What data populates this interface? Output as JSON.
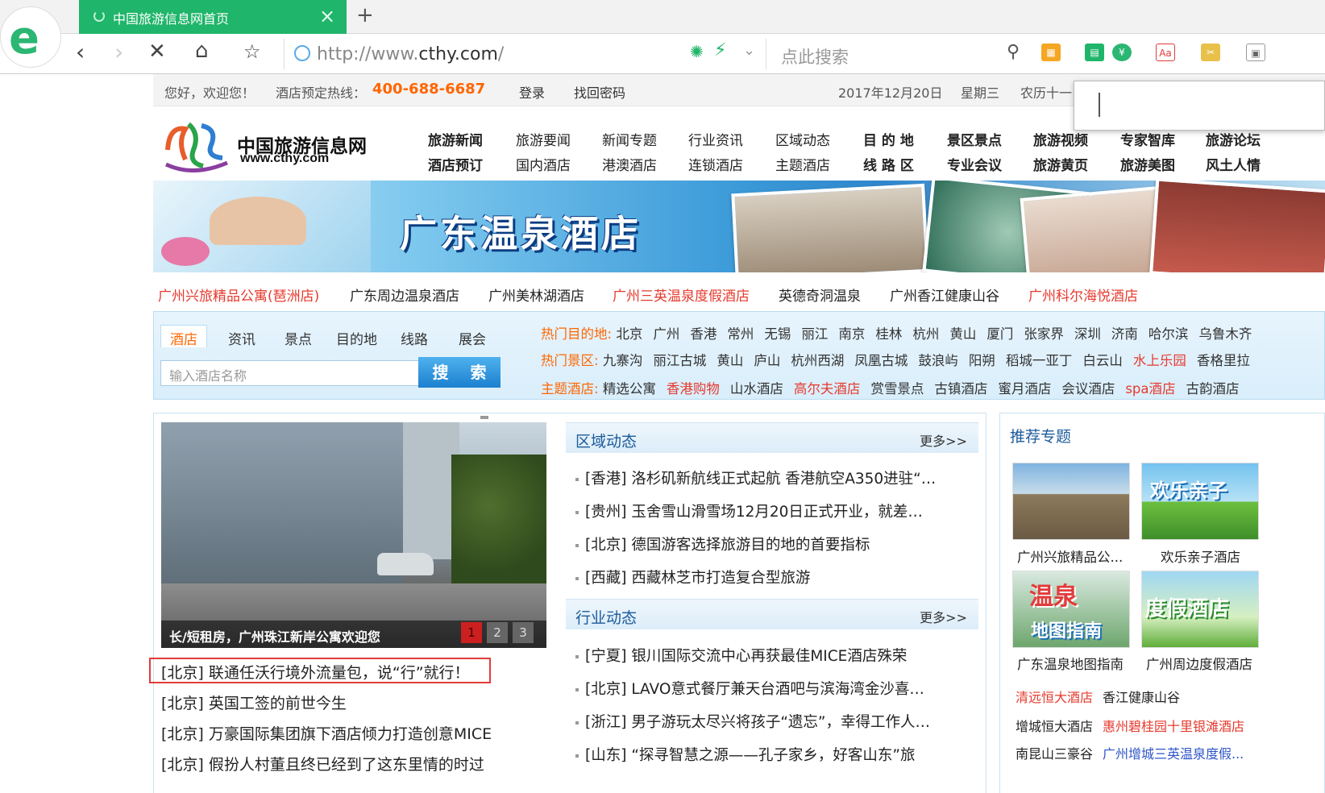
{
  "browser": {
    "tab_title": "中国旅游信息网首页",
    "tab_close": "×",
    "new_tab": "+",
    "url_prefix": "http://www.",
    "url_domain": "cthy.com",
    "url_suffix": "/",
    "search_placeholder": "点此搜索"
  },
  "topbar": {
    "greeting": "您好，欢迎您！",
    "hotline_label": "酒店预定热线：",
    "hotline": "400-688-6687",
    "login": "登录",
    "recover": "找回密码",
    "date": "2017年12月20日",
    "weekday": "星期三",
    "lunar": "农历十一"
  },
  "site": {
    "name": "中国旅游信息网",
    "url": "www.cthy.com"
  },
  "main_nav": {
    "row1": [
      "旅游新闻",
      "旅游要闻",
      "新闻专题",
      "行业资讯",
      "区域动态",
      "目 的 地",
      "景区景点",
      "旅游视频",
      "专家智库",
      "旅游论坛"
    ],
    "row2": [
      "酒店预订",
      "国内酒店",
      "港澳酒店",
      "连锁酒店",
      "主题酒店",
      "线 路 区",
      "专业会议",
      "旅游黄页",
      "旅游美图",
      "风土人情"
    ]
  },
  "banner": {
    "title": "广东温泉酒店"
  },
  "hot_links": [
    "广州兴旅精品公寓(琶洲店)",
    "广东周边温泉酒店",
    "广州美林湖酒店",
    "广州三英温泉度假酒店",
    "英德奇洞温泉",
    "广州香江健康山谷",
    "广州科尔海悦酒店"
  ],
  "search": {
    "tabs": [
      "酒店",
      "资讯",
      "景点",
      "目的地",
      "线路",
      "展会"
    ],
    "input_placeholder": "输入酒店名称",
    "button": "搜 索",
    "hot_dest_label": "热门目的地:",
    "hot_dest": [
      "北京",
      "广州",
      "香港",
      "常州",
      "无锡",
      "丽江",
      "南京",
      "桂林",
      "杭州",
      "黄山",
      "厦门",
      "张家界",
      "深圳",
      "济南",
      "哈尔滨",
      "乌鲁木齐"
    ],
    "hot_scenic_label": "热门景区:",
    "hot_scenic": [
      "九寨沟",
      "丽江古城",
      "黄山",
      "庐山",
      "杭州西湖",
      "凤凰古城",
      "鼓浪屿",
      "阳朔",
      "稻城一亚丁",
      "白云山",
      "水上乐园",
      "香格里拉"
    ],
    "theme_label": "主题酒店:",
    "theme": [
      "精选公寓",
      "香港购物",
      "山水酒店",
      "高尔夫酒店",
      "赏雪景点",
      "古镇酒店",
      "蜜月酒店",
      "会议酒店",
      "spa酒店",
      "古韵酒店"
    ]
  },
  "slideshow": {
    "caption": "长/短租房，广州珠江新岸公寓欢迎您",
    "pages": [
      "1",
      "2",
      "3"
    ]
  },
  "left_news": [
    "[北京] 联通任沃行境外流量包，说“行”就行！",
    "[北京] 英国工签的前世今生",
    "[北京] 万豪国际集团旗下酒店倾力打造创意MICE",
    "[北京] 假扮人村董且终已经到了这东里情的时过"
  ],
  "regional": {
    "title": "区域动态",
    "more": "更多>>",
    "items": [
      "[香港] 洛杉矶新航线正式起航 香港航空A350进驻“…",
      "[贵州] 玉舍雪山滑雪场12月20日正式开业，就差…",
      "[北京] 德国游客选择旅游目的地的首要指标",
      "[西藏] 西藏林芝市打造复合型旅游"
    ]
  },
  "industry": {
    "title": "行业动态",
    "more": "更多>>",
    "items": [
      "[宁夏] 银川国际交流中心再获最佳MICE酒店殊荣",
      "[北京] LAVO意式餐厅兼天台酒吧与滨海湾金沙喜…",
      "[浙江] 男子游玩太尽兴将孩子“遗忘”，幸得工作人…",
      "[山东] “探寻智慧之源——孔子家乡，好客山东”旅"
    ]
  },
  "recommend": {
    "title": "推荐专题",
    "thumbs": [
      "广州兴旅精品公...",
      "欢乐亲子酒店",
      "广东温泉地图指南",
      "广州周边度假酒店"
    ],
    "thumb_texts": [
      "欢乐亲子",
      "温泉",
      "地图指南",
      "度假酒店"
    ],
    "links_row1": [
      "清远恒大酒店",
      "香江健康山谷"
    ],
    "links_row2": [
      "增城恒大酒店",
      "惠州碧桂园十里银滩酒店"
    ],
    "links_row3": [
      "南昆山三豪谷",
      "广州增城三英温泉度假..."
    ]
  },
  "colors": {
    "accent": "#1fb56a",
    "orange": "#ff6600",
    "red": "#e63a2e",
    "link_blue": "#1c5b9a"
  }
}
